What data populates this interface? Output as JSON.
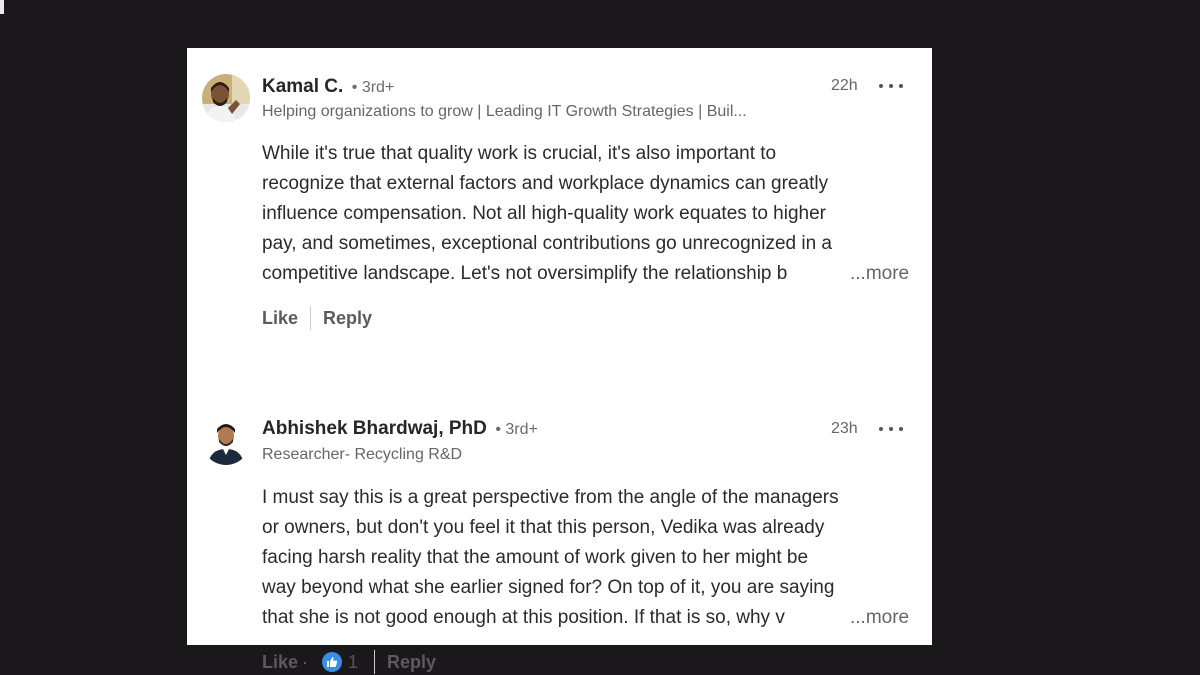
{
  "comments": [
    {
      "author": "Kamal C.",
      "degree": "• 3rd+",
      "headline": "Helping organizations to grow | Leading IT Growth Strategies | Buil...",
      "time": "22h",
      "lines": [
        "While it's true that quality work is crucial, it's also important to",
        "recognize that external factors and workplace dynamics can greatly",
        "influence compensation. Not all high-quality work equates to higher",
        "pay, and sometimes, exceptional contributions go unrecognized in a",
        "competitive landscape. Let's not oversimplify the relationship b"
      ],
      "see_more": "...more",
      "like_label": "Like",
      "reply_label": "Reply",
      "icons": {
        "avatar": "avatar-photo-icon",
        "menu": "ellipsis-icon"
      }
    },
    {
      "author": "Abhishek Bhardwaj, PhD",
      "degree": "• 3rd+",
      "headline": "Researcher- Recycling R&D",
      "time": "23h",
      "lines": [
        "I must say this is a great perspective from the angle of the managers",
        "or owners, but don't you feel it that this person, Vedika was already",
        "facing harsh reality that the amount of work given to her might be",
        "way beyond what she earlier signed for? On top of it, you are saying",
        "that she is not good enough at this position. If that is so, why v"
      ],
      "see_more": "...more",
      "like_label": "Like",
      "reaction_separator": "·",
      "reaction_count": "1",
      "reply_label": "Reply",
      "icons": {
        "avatar": "avatar-photo-icon",
        "menu": "ellipsis-icon",
        "reaction": "thumbs-up-icon"
      }
    }
  ],
  "colors": {
    "background": "#1b181c",
    "panel": "#ffffff",
    "reaction_blue": "#378fe9",
    "text": "#2b2b2b",
    "muted": "#666666"
  }
}
